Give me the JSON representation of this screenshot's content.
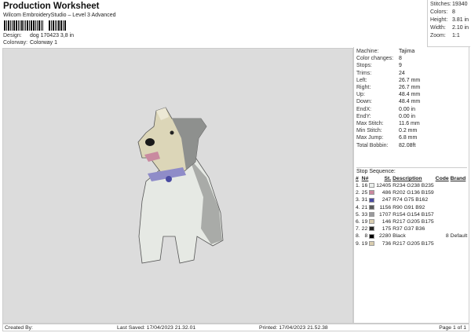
{
  "header": {
    "title": "Production Worksheet",
    "subtitle": "Wilcom EmbroideryStudio – Level 3 Advanced",
    "design_label": "Design:",
    "design_value": "dog 170423 3,8 in",
    "colorway_label": "Colorway:",
    "colorway_value": "Colorway 1"
  },
  "summary": [
    {
      "label": "Stitches:",
      "value": "19340"
    },
    {
      "label": "Colors:",
      "value": "8"
    },
    {
      "label": "Height:",
      "value": "3.81 in"
    },
    {
      "label": "Width:",
      "value": "2.10 in"
    },
    {
      "label": "Zoom:",
      "value": "1:1"
    }
  ],
  "properties": [
    {
      "label": "Machine:",
      "value": "Tajima"
    },
    {
      "label": "Color changes:",
      "value": "8"
    },
    {
      "label": "Stops:",
      "value": "9"
    },
    {
      "label": "Trims:",
      "value": "24"
    },
    {
      "label": "Left:",
      "value": "26.7 mm"
    },
    {
      "label": "Right:",
      "value": "26.7 mm"
    },
    {
      "label": "Up:",
      "value": "48.4 mm"
    },
    {
      "label": "Down:",
      "value": "48.4 mm"
    },
    {
      "label": "EndX:",
      "value": "0.00 in"
    },
    {
      "label": "EndY:",
      "value": "0.00 in"
    },
    {
      "label": "Max Stitch:",
      "value": "11.6 mm"
    },
    {
      "label": "Min Stitch:",
      "value": "0.2 mm"
    },
    {
      "label": "Max Jump:",
      "value": "6.8 mm"
    },
    {
      "label": "Total Bobbin:",
      "value": "82.08ft"
    }
  ],
  "stop_sequence": {
    "title": "Stop Sequence:",
    "columns": [
      "#",
      "N#",
      "St.",
      "Description",
      "Code",
      "Brand"
    ],
    "rows": [
      {
        "n": "1.",
        "nn": "16",
        "color": "#eaeeeb",
        "st": "12405",
        "desc": "R234 G238 B235",
        "code": "",
        "brand": ""
      },
      {
        "n": "2.",
        "nn": "25",
        "color": "#ca889f",
        "st": "486",
        "desc": "R202 G136 B159",
        "code": "",
        "brand": ""
      },
      {
        "n": "3.",
        "nn": "31",
        "color": "#4a4ba2",
        "st": "247",
        "desc": "R74 G75 B162",
        "code": "",
        "brand": ""
      },
      {
        "n": "4.",
        "nn": "21",
        "color": "#5a5b5c",
        "st": "1156",
        "desc": "R90 G91 B92",
        "code": "",
        "brand": ""
      },
      {
        "n": "5.",
        "nn": "33",
        "color": "#9a9a9d",
        "st": "1707",
        "desc": "R154 G154 B157",
        "code": "",
        "brand": ""
      },
      {
        "n": "6.",
        "nn": "19",
        "color": "#d9cdaf",
        "st": "146",
        "desc": "R217 G205 B175",
        "code": "",
        "brand": ""
      },
      {
        "n": "7.",
        "nn": "22",
        "color": "#252524",
        "st": "175",
        "desc": "R37 G37 B36",
        "code": "",
        "brand": ""
      },
      {
        "n": "8.",
        "nn": "8",
        "color": "#000000",
        "st": "2280",
        "desc": "Black",
        "code": "8",
        "brand": "Default"
      },
      {
        "n": "9.",
        "nn": "19",
        "color": "#d9cdaf",
        "st": "736",
        "desc": "R217 G205 B175",
        "code": "",
        "brand": ""
      }
    ]
  },
  "footer": {
    "created_by": "Created By:",
    "last_saved": "Last Saved: 17/04/2023 21.32.01",
    "printed": "Printed: 17/04/2023 21.52.38",
    "page": "Page 1 of 1"
  }
}
